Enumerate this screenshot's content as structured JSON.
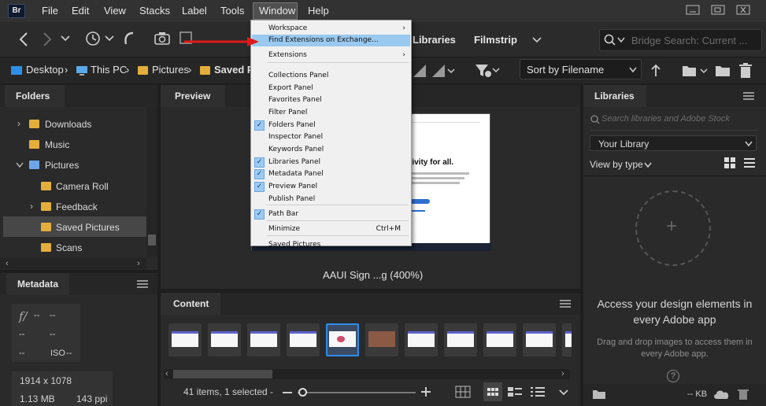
{
  "app": {
    "logo": "Br"
  },
  "menubar": {
    "items": [
      "File",
      "Edit",
      "View",
      "Stacks",
      "Label",
      "Tools",
      "Window",
      "Help"
    ],
    "active": "Window"
  },
  "toolbar": {
    "workspaces": [
      "Libraries",
      "Filmstrip"
    ],
    "search_placeholder": "Bridge Search: Current ..."
  },
  "pathbar": {
    "crumbs": [
      "Desktop",
      "This PC",
      "Pictures",
      "Saved P"
    ],
    "sort_label": "Sort by Filename"
  },
  "folders": {
    "title": "Folders",
    "items": [
      {
        "label": "Downloads",
        "expandable": true
      },
      {
        "label": "Music",
        "expandable": false
      },
      {
        "label": "Pictures",
        "expandable": true,
        "expanded": true
      },
      {
        "label": "Camera Roll",
        "expandable": false
      },
      {
        "label": "Feedback",
        "expandable": true
      },
      {
        "label": "Saved Pictures",
        "expandable": false,
        "selected": true
      },
      {
        "label": "Scans",
        "expandable": false
      }
    ]
  },
  "metadata": {
    "title": "Metadata",
    "aperture": "--",
    "shutter": "--",
    "exp1": "--",
    "exp2": "--",
    "wb": "--",
    "iso_label": "ISO",
    "iso": "--",
    "dimensions": "1914 x 1078",
    "size": "1.13 MB",
    "ppi": "143 ppi"
  },
  "preview": {
    "title": "Preview",
    "caption": "AAUI Sign ...g (400%)",
    "webpage_heading": "tivity for all."
  },
  "window_menu": {
    "items": [
      {
        "label": "Workspace",
        "submenu": true
      },
      {
        "label": "Find Extensions on Exchange...",
        "highlighted": true
      },
      {
        "label": "Extensions",
        "submenu": true
      },
      {
        "separator": true
      },
      {
        "label": "Collections Panel"
      },
      {
        "label": "Export Panel"
      },
      {
        "label": "Favorites Panel"
      },
      {
        "label": "Filter Panel"
      },
      {
        "label": "Folders Panel",
        "checked": true
      },
      {
        "label": "Inspector Panel"
      },
      {
        "label": "Keywords Panel"
      },
      {
        "label": "Libraries Panel",
        "checked": true
      },
      {
        "label": "Metadata Panel",
        "checked": true
      },
      {
        "label": "Preview Panel",
        "checked": true
      },
      {
        "label": "Publish Panel"
      },
      {
        "separator": true
      },
      {
        "label": "Path Bar",
        "checked": true
      },
      {
        "separator": true
      },
      {
        "label": "Minimize",
        "shortcut": "Ctrl+M"
      },
      {
        "separator": true
      },
      {
        "label": "Saved Pictures"
      }
    ]
  },
  "content": {
    "title": "Content",
    "status": "41 items, 1 selected -",
    "thumbnail_count": 11,
    "selected_index": 4
  },
  "libraries": {
    "title": "Libraries",
    "search_placeholder": "Search libraries and Adobe Stock",
    "library_select": "Your Library",
    "view_by": "View by type",
    "headline": "Access your design elements in every Adobe app",
    "subtext": "Drag and drop images to access them in every Adobe app.",
    "help": "?",
    "kb": "-- KB"
  },
  "colors": {
    "accent": "#2d8ceb",
    "menu_highlight": "#99c9ef",
    "arrow": "#e0191b",
    "folder": "#e3ae3b"
  }
}
